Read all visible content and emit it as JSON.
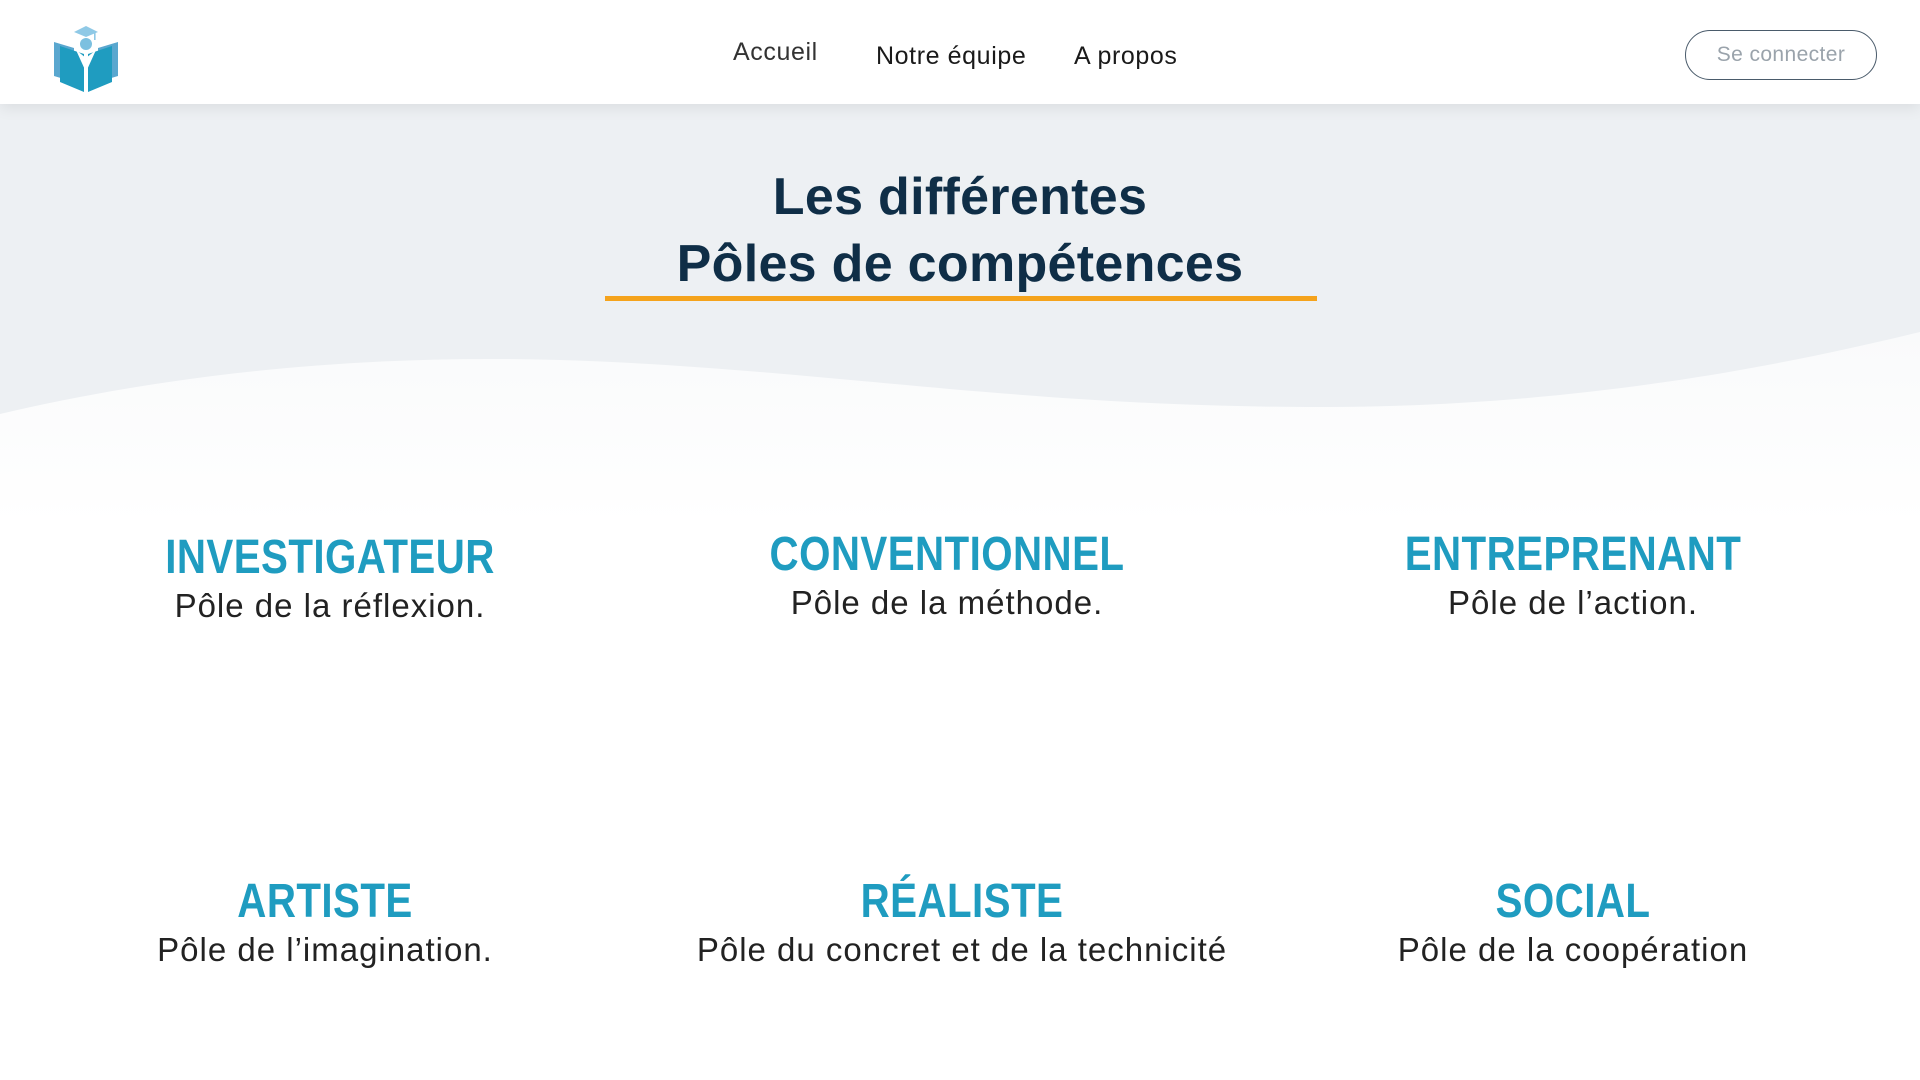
{
  "nav": {
    "logo_icon": "book-graduate-logo-icon",
    "links": [
      {
        "label": "Accueil"
      },
      {
        "label": "Notre équipe"
      },
      {
        "label": "A propos"
      }
    ],
    "login_label": "Se connecter"
  },
  "section": {
    "title_line1": "Les différentes",
    "title_line2": "Pôles de compétences"
  },
  "poles": [
    {
      "name": "INVESTIGATEUR",
      "description": "Pôle de la réflexion."
    },
    {
      "name": "CONVENTIONNEL",
      "description": "Pôle de la méthode."
    },
    {
      "name": "ENTREPRENANT",
      "description": "Pôle de l’action."
    },
    {
      "name": "ARTISTE",
      "description": "Pôle de l’imagination."
    },
    {
      "name": "RÉALISTE",
      "description": "Pôle du concret et de la technicité"
    },
    {
      "name": "SOCIAL",
      "description": "Pôle de la coopération"
    }
  ],
  "colors": {
    "title": "#0f2e47",
    "accent_underline": "#f5a31c",
    "pole_name": "#1f9cc0",
    "hero_background": "#edf0f3"
  }
}
